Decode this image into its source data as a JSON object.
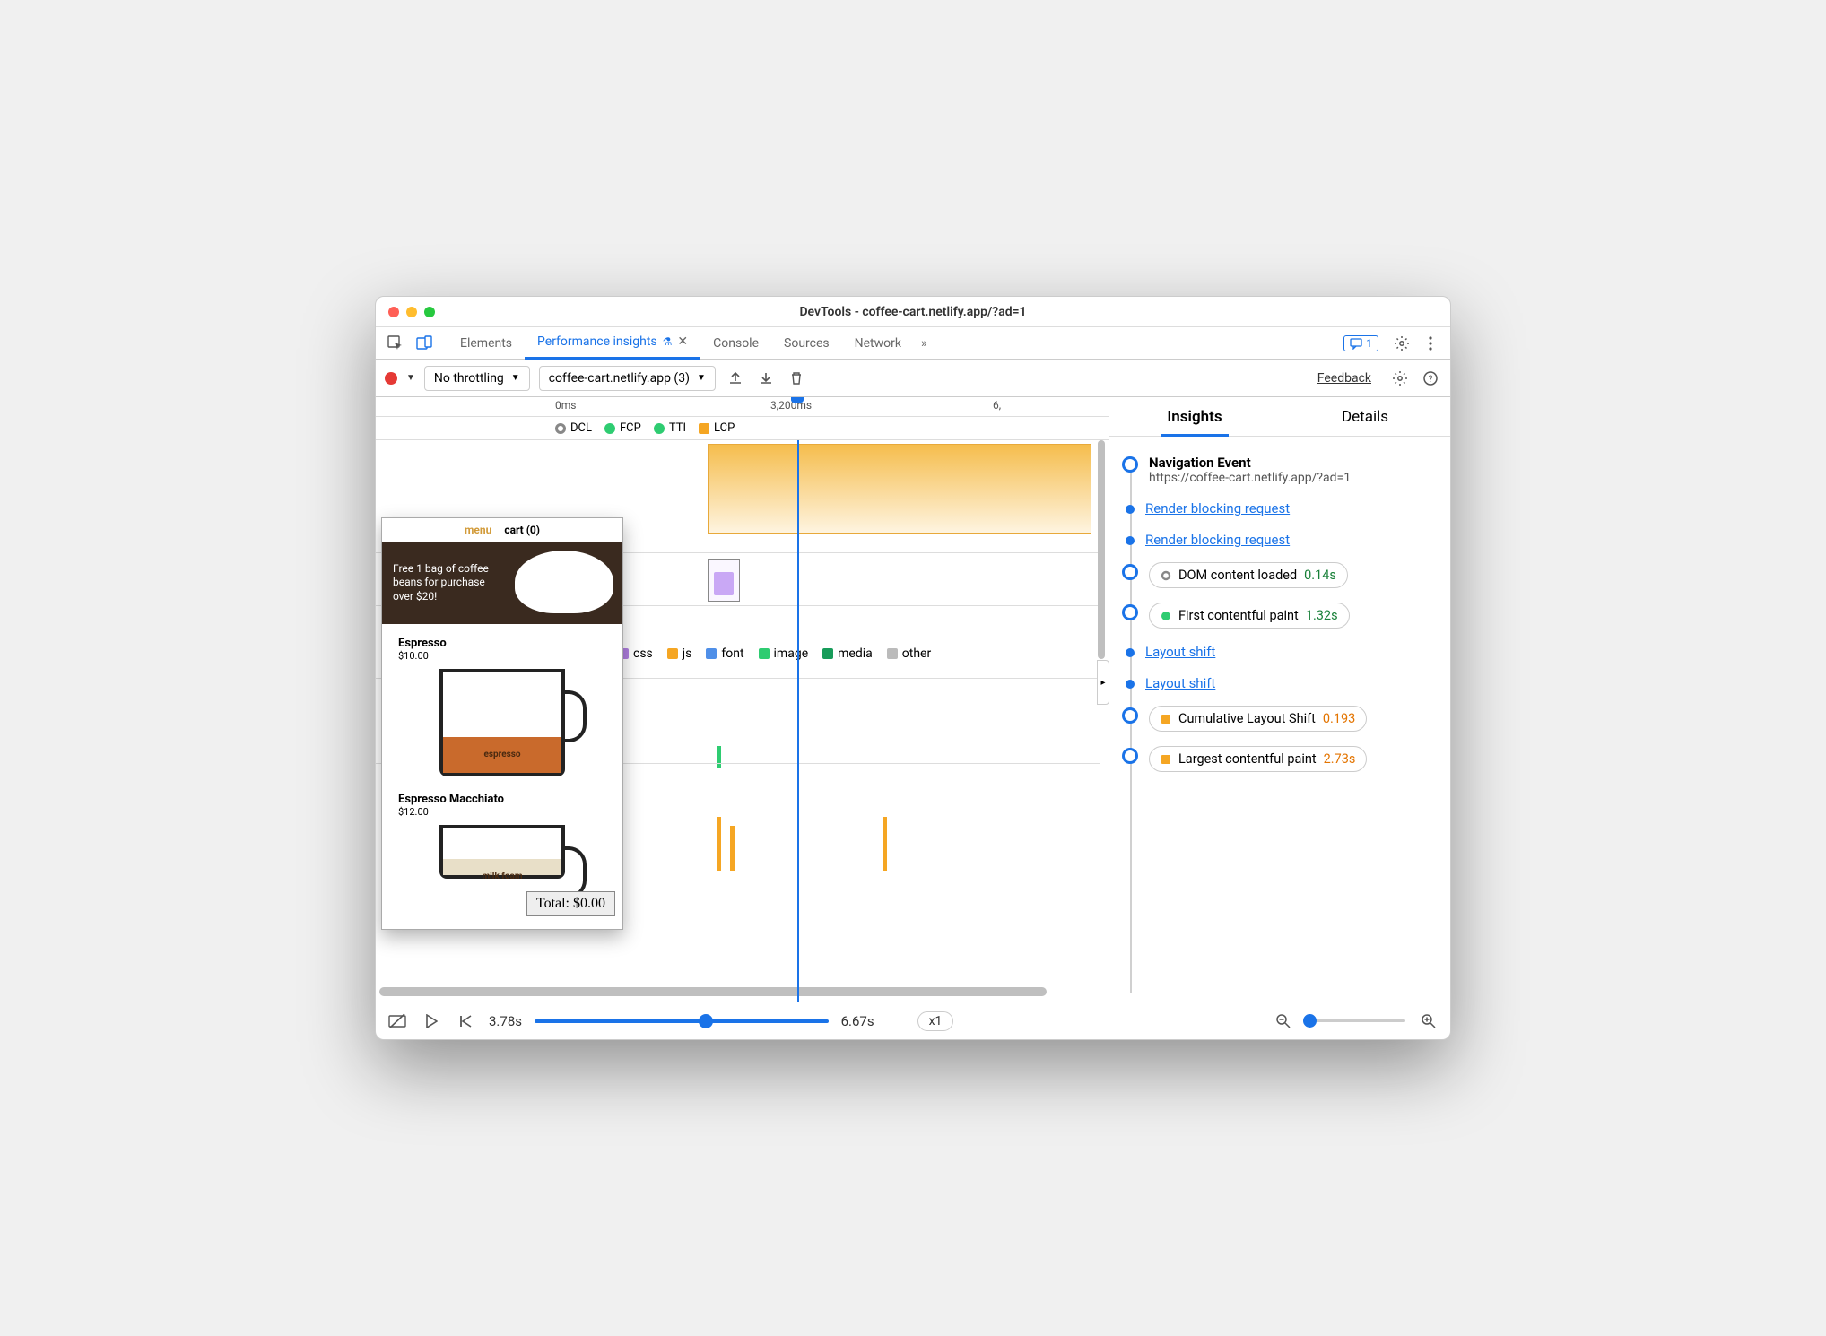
{
  "window": {
    "title": "DevTools - coffee-cart.netlify.app/?ad=1"
  },
  "tabs": {
    "elements": "Elements",
    "perf_insights": "Performance insights",
    "console": "Console",
    "sources": "Sources",
    "network": "Network"
  },
  "messages_count": "1",
  "toolbar": {
    "throttling": "No throttling",
    "page_select": "coffee-cart.netlify.app (3)",
    "feedback": "Feedback"
  },
  "ruler": {
    "t0": "0ms",
    "t1": "3,200ms",
    "t2": "6,"
  },
  "markers": {
    "dcl": "DCL",
    "fcp": "FCP",
    "tti": "TTI",
    "lcp": "LCP"
  },
  "legend": {
    "css": "css",
    "js": "js",
    "font": "font",
    "image": "image",
    "media": "media",
    "other": "other"
  },
  "legend_colors": {
    "css": "#b07fe0",
    "js": "#f5a623",
    "font": "#4f8fe8",
    "image": "#2ecc71",
    "media": "#179c5a",
    "other": "#bbb"
  },
  "screenshot": {
    "menu": "menu",
    "cart": "cart (0)",
    "banner": "Free 1 bag of coffee beans for purchase over $20!",
    "prod1_name": "Espresso",
    "prod1_price": "$10.00",
    "fill1": "espresso",
    "prod2_name": "Espresso Macchiato",
    "prod2_price": "$12.00",
    "fill2": "milk foam",
    "total": "Total: $0.00"
  },
  "bottom": {
    "t_current": "3.78s",
    "t_end": "6.67s",
    "zoom": "x1"
  },
  "insights": {
    "tab_insights": "Insights",
    "tab_details": "Details",
    "nav_title": "Navigation Event",
    "nav_url": "https://coffee-cart.netlify.app/?ad=1",
    "rbr": "Render blocking request",
    "dcl_label": "DOM content loaded",
    "dcl_time": "0.14s",
    "fcp_label": "First contentful paint",
    "fcp_time": "1.32s",
    "ls": "Layout shift",
    "cls_label": "Cumulative Layout Shift",
    "cls_time": "0.193",
    "lcp_label": "Largest contentful paint",
    "lcp_time": "2.73s"
  }
}
